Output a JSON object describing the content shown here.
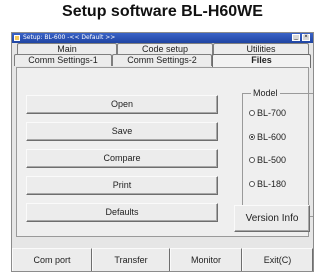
{
  "caption": "Setup software BL-H60WE",
  "window": {
    "title": "Setup: BL-600 -<< Default >>",
    "minimize": "_",
    "close": "×"
  },
  "tabs_row1": [
    {
      "label": "Main"
    },
    {
      "label": "Code setup"
    },
    {
      "label": "Utilities"
    }
  ],
  "tabs_row2": [
    {
      "label": "Comm Settings-1"
    },
    {
      "label": "Comm Settings-2"
    },
    {
      "label": "Files",
      "active": true
    }
  ],
  "actions": {
    "open": "Open",
    "save": "Save",
    "compare": "Compare",
    "print": "Print",
    "defaults": "Defaults"
  },
  "model": {
    "legend": "Model",
    "options": [
      {
        "label": "BL-700",
        "selected": false
      },
      {
        "label": "BL-600",
        "selected": true
      },
      {
        "label": "BL-500",
        "selected": false
      },
      {
        "label": "BL-180",
        "selected": false
      }
    ]
  },
  "version_button": "Version Info",
  "bottom": {
    "com_port": "Com port",
    "transfer": "Transfer",
    "monitor": "Monitor",
    "exit": "Exit(C)"
  }
}
